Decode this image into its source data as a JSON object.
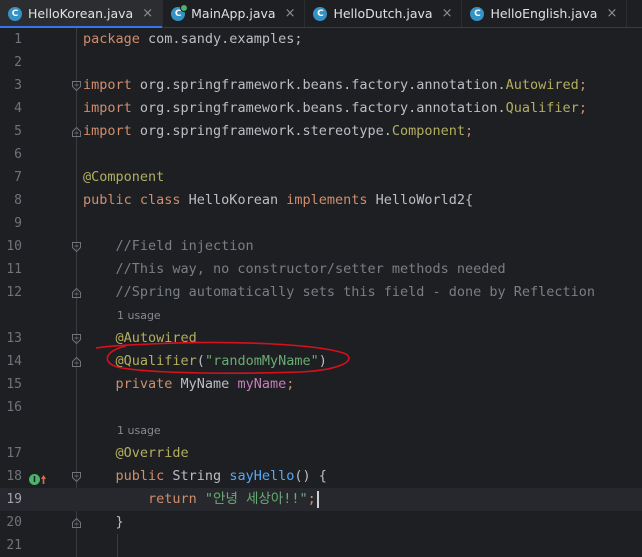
{
  "tabs": [
    {
      "label": "HelloKorean.java",
      "icon": "C",
      "active": true
    },
    {
      "label": "MainApp.java",
      "icon": "C",
      "runnable": true
    },
    {
      "label": "HelloDutch.java",
      "icon": "C"
    },
    {
      "label": "HelloEnglish.java",
      "icon": "C"
    }
  ],
  "close_glyph": "×",
  "lines": [
    {
      "n": "1",
      "t": [
        [
          "kw",
          "package "
        ],
        [
          "",
          "com.sandy.examples;"
        ]
      ]
    },
    {
      "n": "2",
      "t": []
    },
    {
      "n": "3",
      "t": [
        [
          "kw",
          "import "
        ],
        [
          "",
          "org.springframework.beans.factory.annotation."
        ],
        [
          "an",
          "Autowired"
        ],
        [
          "kw",
          ";"
        ]
      ],
      "fold": "open"
    },
    {
      "n": "4",
      "t": [
        [
          "kw",
          "import "
        ],
        [
          "",
          "org.springframework.beans.factory.annotation."
        ],
        [
          "an",
          "Qualifier"
        ],
        [
          "kw",
          ";"
        ]
      ]
    },
    {
      "n": "5",
      "t": [
        [
          "kw",
          "import "
        ],
        [
          "",
          "org.springframework.stereotype."
        ],
        [
          "an",
          "Component"
        ],
        [
          "kw",
          ";"
        ]
      ],
      "fold": "close"
    },
    {
      "n": "6",
      "t": []
    },
    {
      "n": "7",
      "t": [
        [
          "an",
          "@Component"
        ]
      ]
    },
    {
      "n": "8",
      "t": [
        [
          "kw",
          "public class "
        ],
        [
          "",
          "HelloKorean "
        ],
        [
          "kw",
          "implements "
        ],
        [
          "",
          "HelloWorld2{"
        ]
      ]
    },
    {
      "n": "9",
      "t": []
    },
    {
      "n": "10",
      "t": [
        [
          "cm",
          "    //Field injection"
        ]
      ],
      "fold": "open"
    },
    {
      "n": "11",
      "t": [
        [
          "cm",
          "    //This way, no constructor/setter methods needed"
        ]
      ]
    },
    {
      "n": "12",
      "t": [
        [
          "cm",
          "    //Spring automatically sets this field - done by Reflection"
        ]
      ],
      "fold": "close"
    },
    {
      "hint": "1 usage"
    },
    {
      "n": "13",
      "t": [
        [
          "an",
          "    @Autowired"
        ]
      ],
      "fold": "open"
    },
    {
      "n": "14",
      "t": [
        [
          "an",
          "    @Qualifier"
        ],
        [
          "",
          "("
        ],
        [
          "st",
          "\"randomMyName\""
        ],
        [
          "",
          ")"
        ]
      ],
      "fold": "close"
    },
    {
      "n": "15",
      "t": [
        [
          "kw",
          "    private "
        ],
        [
          "",
          "MyName "
        ],
        [
          "fd",
          "myName"
        ],
        [
          "kw",
          ";"
        ]
      ]
    },
    {
      "n": "16",
      "t": []
    },
    {
      "hint": "1 usage"
    },
    {
      "n": "17",
      "t": [
        [
          "an",
          "    @Override"
        ]
      ]
    },
    {
      "n": "18",
      "t": [
        [
          "kw",
          "    public "
        ],
        [
          "",
          "String "
        ],
        [
          "fn",
          "sayHello"
        ],
        [
          "",
          "() {"
        ]
      ],
      "fold": "open",
      "gutter": "override"
    },
    {
      "n": "19",
      "t": [
        [
          "kw",
          "        return "
        ],
        [
          "st",
          "\"안녕 세상아!!\""
        ],
        [
          "kw",
          ";"
        ]
      ],
      "current": true
    },
    {
      "n": "20",
      "t": [
        [
          "",
          "    }"
        ]
      ],
      "fold": "close"
    },
    {
      "n": "21",
      "t": []
    }
  ]
}
